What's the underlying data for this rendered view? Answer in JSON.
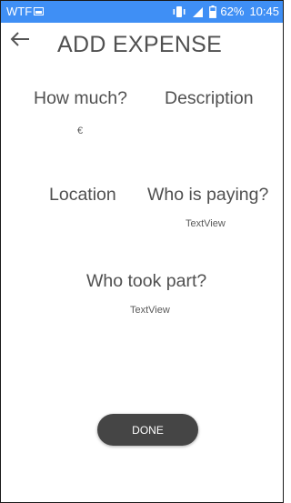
{
  "status_bar": {
    "carrier": "WTF",
    "battery": "62%",
    "time": "10:45",
    "background_color": "#3f8ff5",
    "icons": [
      "image-icon",
      "vibrate-icon",
      "signal-icon",
      "battery-icon"
    ]
  },
  "header": {
    "back_icon": "arrow-left-icon",
    "title": "ADD EXPENSE"
  },
  "form": {
    "how_much_label": "How much?",
    "currency_symbol": "€",
    "description_label": "Description",
    "location_label": "Location",
    "who_is_paying_label": "Who is paying?",
    "who_is_paying_value": "TextView",
    "who_took_part_label": "Who took part?",
    "who_took_part_value": "TextView"
  },
  "actions": {
    "done_label": "DONE",
    "done_color": "#454545"
  }
}
